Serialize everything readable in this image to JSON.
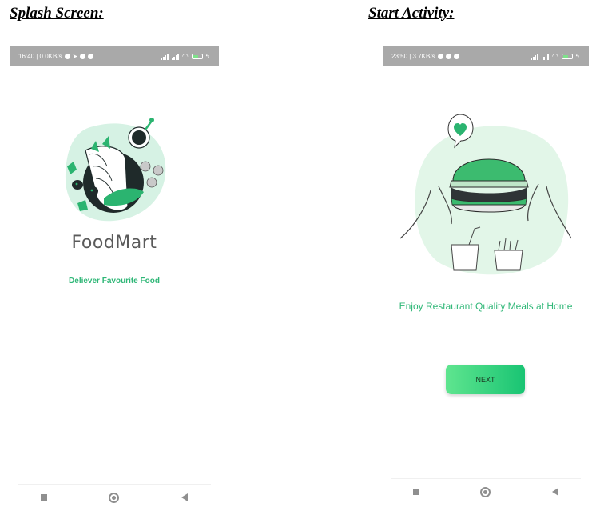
{
  "captions": {
    "left": "Splash Screen:",
    "right": "Start Activity:"
  },
  "splash": {
    "status": {
      "time_info": "16:40 | 0.0KB/s"
    },
    "brand_name": "FoodMart",
    "tagline": "Deliever Favourite Food"
  },
  "start": {
    "status": {
      "time_info": "23:50 | 3.7KB/s"
    },
    "tagline": "Enjoy Restaurant Quality Meals at Home",
    "next_label": "NEXT"
  },
  "colors": {
    "accent": "#2fb777",
    "button_start": "#5fe58f",
    "button_end": "#19c473",
    "statusbar": "#a9a9a9"
  },
  "icons": [
    "settings-icon",
    "send-icon",
    "app-icon",
    "signal-icon",
    "wifi-icon",
    "battery-icon",
    "charging-icon",
    "recents-icon",
    "home-icon",
    "back-icon"
  ]
}
